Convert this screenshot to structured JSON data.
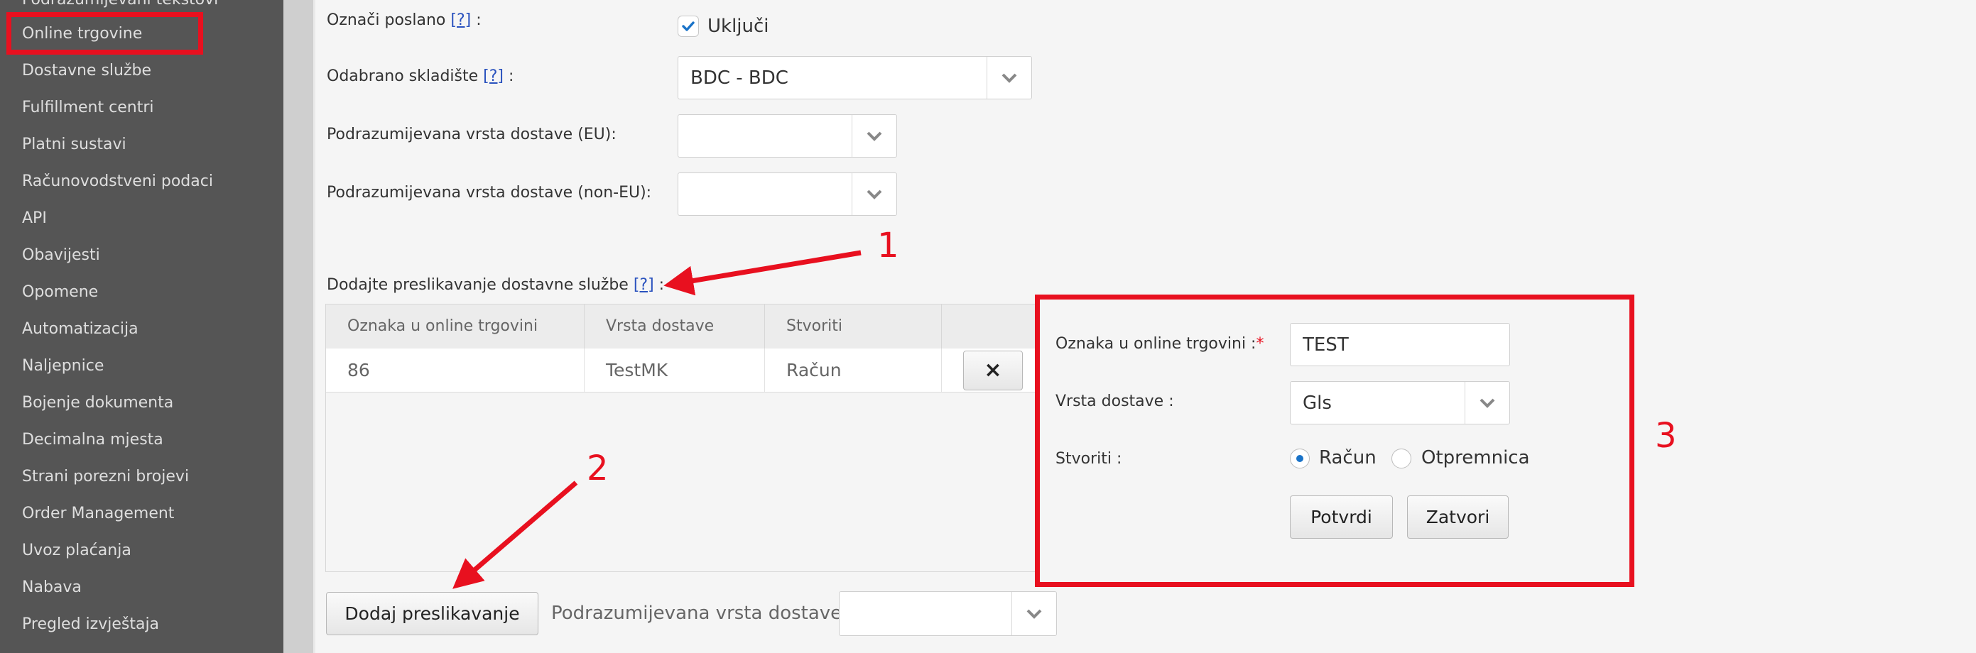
{
  "sidebar": {
    "items": [
      {
        "label": "Podrazumijevani tekstovi"
      },
      {
        "label": "Online trgovine"
      },
      {
        "label": "Dostavne službe"
      },
      {
        "label": "Fulfillment centri"
      },
      {
        "label": "Platni sustavi"
      },
      {
        "label": "Računovodstveni podaci"
      },
      {
        "label": "API"
      },
      {
        "label": "Obavijesti"
      },
      {
        "label": "Opomene"
      },
      {
        "label": "Automatizacija"
      },
      {
        "label": "Naljepnice"
      },
      {
        "label": "Bojenje dokumenta"
      },
      {
        "label": "Decimalna mjesta"
      },
      {
        "label": "Strani porezni brojevi"
      },
      {
        "label": "Order Management"
      },
      {
        "label": "Uvoz plaćanja"
      },
      {
        "label": "Nabava"
      },
      {
        "label": "Pregled izvještaja"
      }
    ]
  },
  "form": {
    "help_link": "[?]",
    "label_suffix": " :",
    "oznaci_poslano_label": "Označi poslano",
    "ukljuci_label": "Uključi",
    "ukljuci_checked": true,
    "skladiste_label": "Odabrano skladište",
    "skladiste_value": "BDC - BDC",
    "vrsta_eu_label": "Podrazumijevana vrsta dostave (EU):",
    "vrsta_eu_value": "",
    "vrsta_noneu_label": "Podrazumijevana vrsta dostave (non-EU):",
    "vrsta_noneu_value": "",
    "mapping_label": "Dodajte preslikavanje dostavne službe"
  },
  "table": {
    "columns": [
      "Oznaka u online trgovini",
      "Vrsta dostave",
      "Stvoriti"
    ],
    "rows": [
      {
        "oznaka": "86",
        "vrsta": "TestMK",
        "stvoriti": "Račun",
        "delete_icon": "×"
      }
    ]
  },
  "footer": {
    "add_button": "Dodaj preslikavanje",
    "default_label": "Podrazumijevana vrsta dostave :",
    "default_value": ""
  },
  "popup": {
    "oznaka_label": "Oznaka u online trgovini :",
    "required_mark": "*",
    "oznaka_value": "TEST",
    "vrsta_label": "Vrsta dostave :",
    "vrsta_value": "Gls",
    "stvoriti_label": "Stvoriti :",
    "radio_options": [
      {
        "label": "Račun",
        "selected": true
      },
      {
        "label": "Otpremnica",
        "selected": false
      }
    ],
    "confirm_button": "Potvrdi",
    "close_button": "Zatvori"
  },
  "annotations": {
    "one": "1",
    "two": "2",
    "three": "3",
    "color": "#e8101f"
  },
  "icons": {
    "chevron": "chevron-down-icon",
    "check": "checkmark-icon",
    "delete": "close-icon"
  }
}
